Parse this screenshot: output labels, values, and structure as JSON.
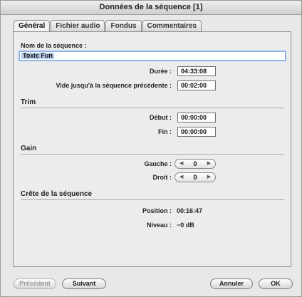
{
  "window": {
    "title": "Données de la séquence [1]"
  },
  "tabs": [
    {
      "label": "Général"
    },
    {
      "label": "Fichier audio"
    },
    {
      "label": "Fondus"
    },
    {
      "label": "Commentaires"
    }
  ],
  "general": {
    "name_label": "Nom de la séquence :",
    "name_value": "Toxic Fun",
    "duration_label": "Durée :",
    "duration_value": "04:33:08",
    "gap_label": "Vide jusqu'à la séquence précédente :",
    "gap_value": "00:02:00"
  },
  "trim": {
    "title": "Trim",
    "start_label": "Début :",
    "start_value": "00:00:00",
    "end_label": "Fin :",
    "end_value": "00:00:00"
  },
  "gain": {
    "title": "Gain",
    "left_label": "Gauche :",
    "left_value": "0",
    "right_label": "Droit :",
    "right_value": "0"
  },
  "peak": {
    "title": "Crête de la séquence",
    "position_label": "Position :",
    "position_value": "00:16:47",
    "level_label": "Niveau :",
    "level_value": "−0 dB"
  },
  "buttons": {
    "previous": "Précédent",
    "next": "Suivant",
    "cancel": "Annuler",
    "ok": "OK"
  },
  "icons": {
    "stepper_left": "left-arrow-icon",
    "stepper_right": "right-arrow-icon"
  }
}
